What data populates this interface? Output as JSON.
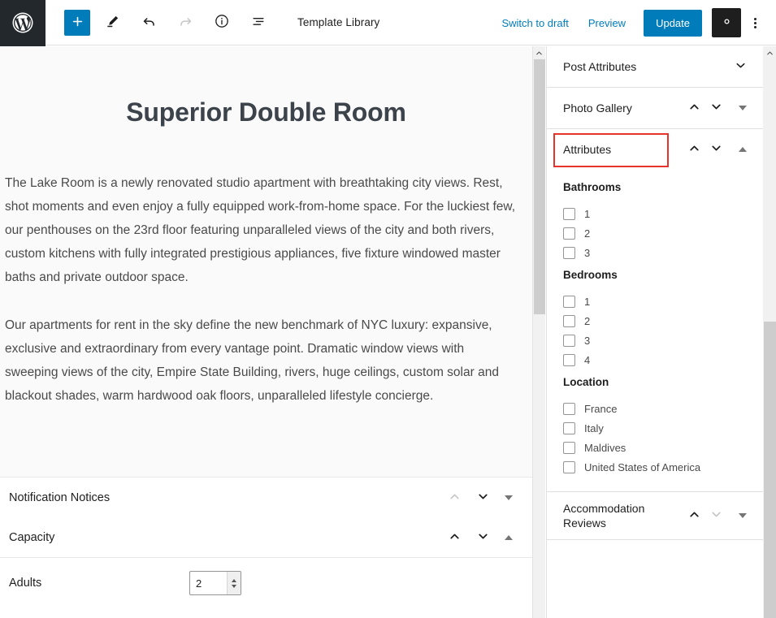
{
  "app": {
    "logo_icon": "wordpress-logo-icon",
    "document_title": "Template Library"
  },
  "toolbar": {
    "add_block_label": "+",
    "add_block_icon": "plus-icon",
    "tools_icon": "pencil-icon",
    "undo_icon": "undo-arrow-icon",
    "redo_icon": "redo-arrow-icon",
    "details_icon": "info-circle-icon",
    "list_view_icon": "list-view-icon",
    "switch_to_draft_label": "Switch to draft",
    "preview_label": "Preview",
    "update_label": "Update",
    "settings_icon": "gear-icon",
    "options_icon": "kebab-menu-icon",
    "accent_color": "#007cba"
  },
  "editor": {
    "post_title": "Superior Double Room",
    "paragraphs": [
      "The Lake Room is a newly renovated studio apartment with breathtaking city views. Rest, shot moments and even enjoy a fully equipped work-from-home space. For the luckiest few, our penthouses on the 23rd floor featuring unparalleled views of the city and both rivers, custom kitchens with fully integrated prestigious appliances, five fixture windowed master baths and private outdoor space.",
      "Our apartments for rent in the sky define the new benchmark of NYC luxury: expansive, exclusive and extraordinary from every vantage point. Dramatic window views with sweeping views of the city, Empire State Building, rivers, huge ceilings, custom solar and blackout shades, warm hardwood oak floors, unparalleled lifestyle concierge."
    ],
    "blocks": [
      {
        "title": "Notification Notices",
        "move_up_icon": "chevron-up-icon",
        "move_down_icon": "chevron-down-icon",
        "move_up_disabled": true,
        "toggle_icon": "triangle-down-icon",
        "expanded": false
      },
      {
        "title": "Capacity",
        "move_up_icon": "chevron-up-icon",
        "move_down_icon": "chevron-down-icon",
        "move_up_disabled": false,
        "toggle_icon": "triangle-up-icon",
        "expanded": true
      }
    ],
    "capacity_fields": [
      {
        "label": "Adults",
        "value": "2",
        "stepper_up_icon": "spinner-up-icon",
        "stepper_down_icon": "spinner-down-icon"
      }
    ]
  },
  "sidebar": {
    "panels": [
      {
        "title": "Post Attributes",
        "collapse_icon": "chevron-down-icon",
        "has_movers": false,
        "highlighted": false
      },
      {
        "title": "Photo Gallery",
        "move_up_icon": "chevron-up-icon",
        "move_down_icon": "chevron-down-icon",
        "toggle_icon": "triangle-down-icon",
        "has_movers": true,
        "highlighted": false,
        "expanded": false
      },
      {
        "title": "Attributes",
        "move_up_icon": "chevron-up-icon",
        "move_down_icon": "chevron-down-icon",
        "toggle_icon": "triangle-up-icon",
        "has_movers": true,
        "highlighted": true,
        "expanded": true
      },
      {
        "title": "Accommodation Reviews",
        "move_up_icon": "chevron-up-icon",
        "move_down_icon": "chevron-down-icon",
        "toggle_icon": "triangle-down-icon",
        "has_movers": true,
        "move_down_disabled": true,
        "highlighted": false,
        "expanded": false
      }
    ],
    "attribute_groups": [
      {
        "title": "Bathrooms",
        "options": [
          {
            "label": "1",
            "checked": false
          },
          {
            "label": "2",
            "checked": false
          },
          {
            "label": "3",
            "checked": false
          }
        ]
      },
      {
        "title": "Bedrooms",
        "options": [
          {
            "label": "1",
            "checked": false
          },
          {
            "label": "2",
            "checked": false
          },
          {
            "label": "3",
            "checked": false
          },
          {
            "label": "4",
            "checked": false
          }
        ]
      },
      {
        "title": "Location",
        "options": [
          {
            "label": "France",
            "checked": false
          },
          {
            "label": "Italy",
            "checked": false
          },
          {
            "label": "Maldives",
            "checked": false
          },
          {
            "label": "United States of America",
            "checked": false
          }
        ]
      }
    ],
    "highlight_color": "#e8322c"
  },
  "scrollbars": {
    "canvas_arrow_icon": "scroll-up-arrow-icon",
    "sidebar_arrow_icon": "scroll-up-arrow-icon"
  }
}
